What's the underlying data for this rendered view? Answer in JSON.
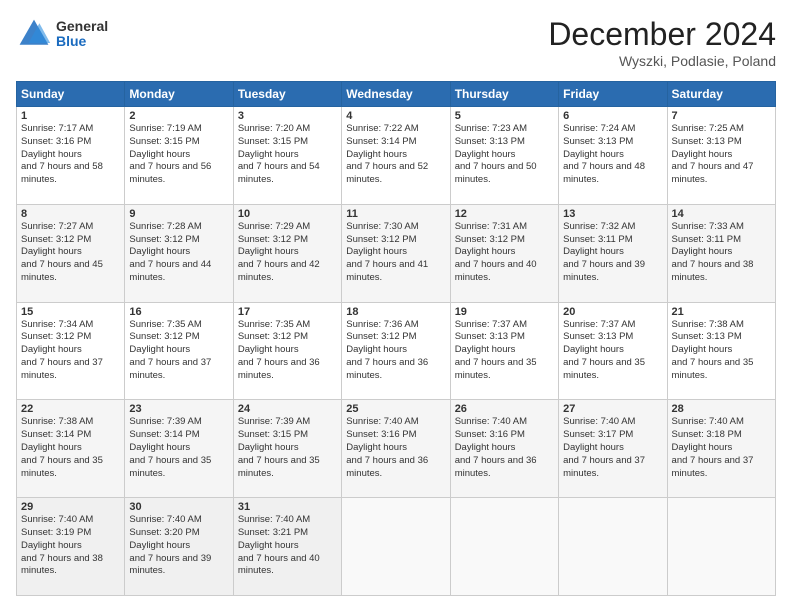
{
  "header": {
    "logo_general": "General",
    "logo_blue": "Blue",
    "title": "December 2024",
    "location": "Wyszki, Podlasie, Poland"
  },
  "days_of_week": [
    "Sunday",
    "Monday",
    "Tuesday",
    "Wednesday",
    "Thursday",
    "Friday",
    "Saturday"
  ],
  "weeks": [
    [
      {
        "day": "1",
        "sunrise": "7:17 AM",
        "sunset": "3:16 PM",
        "daylight": "7 hours and 58 minutes."
      },
      {
        "day": "2",
        "sunrise": "7:19 AM",
        "sunset": "3:15 PM",
        "daylight": "7 hours and 56 minutes."
      },
      {
        "day": "3",
        "sunrise": "7:20 AM",
        "sunset": "3:15 PM",
        "daylight": "7 hours and 54 minutes."
      },
      {
        "day": "4",
        "sunrise": "7:22 AM",
        "sunset": "3:14 PM",
        "daylight": "7 hours and 52 minutes."
      },
      {
        "day": "5",
        "sunrise": "7:23 AM",
        "sunset": "3:13 PM",
        "daylight": "7 hours and 50 minutes."
      },
      {
        "day": "6",
        "sunrise": "7:24 AM",
        "sunset": "3:13 PM",
        "daylight": "7 hours and 48 minutes."
      },
      {
        "day": "7",
        "sunrise": "7:25 AM",
        "sunset": "3:13 PM",
        "daylight": "7 hours and 47 minutes."
      }
    ],
    [
      {
        "day": "8",
        "sunrise": "7:27 AM",
        "sunset": "3:12 PM",
        "daylight": "7 hours and 45 minutes."
      },
      {
        "day": "9",
        "sunrise": "7:28 AM",
        "sunset": "3:12 PM",
        "daylight": "7 hours and 44 minutes."
      },
      {
        "day": "10",
        "sunrise": "7:29 AM",
        "sunset": "3:12 PM",
        "daylight": "7 hours and 42 minutes."
      },
      {
        "day": "11",
        "sunrise": "7:30 AM",
        "sunset": "3:12 PM",
        "daylight": "7 hours and 41 minutes."
      },
      {
        "day": "12",
        "sunrise": "7:31 AM",
        "sunset": "3:12 PM",
        "daylight": "7 hours and 40 minutes."
      },
      {
        "day": "13",
        "sunrise": "7:32 AM",
        "sunset": "3:11 PM",
        "daylight": "7 hours and 39 minutes."
      },
      {
        "day": "14",
        "sunrise": "7:33 AM",
        "sunset": "3:11 PM",
        "daylight": "7 hours and 38 minutes."
      }
    ],
    [
      {
        "day": "15",
        "sunrise": "7:34 AM",
        "sunset": "3:12 PM",
        "daylight": "7 hours and 37 minutes."
      },
      {
        "day": "16",
        "sunrise": "7:35 AM",
        "sunset": "3:12 PM",
        "daylight": "7 hours and 37 minutes."
      },
      {
        "day": "17",
        "sunrise": "7:35 AM",
        "sunset": "3:12 PM",
        "daylight": "7 hours and 36 minutes."
      },
      {
        "day": "18",
        "sunrise": "7:36 AM",
        "sunset": "3:12 PM",
        "daylight": "7 hours and 36 minutes."
      },
      {
        "day": "19",
        "sunrise": "7:37 AM",
        "sunset": "3:13 PM",
        "daylight": "7 hours and 35 minutes."
      },
      {
        "day": "20",
        "sunrise": "7:37 AM",
        "sunset": "3:13 PM",
        "daylight": "7 hours and 35 minutes."
      },
      {
        "day": "21",
        "sunrise": "7:38 AM",
        "sunset": "3:13 PM",
        "daylight": "7 hours and 35 minutes."
      }
    ],
    [
      {
        "day": "22",
        "sunrise": "7:38 AM",
        "sunset": "3:14 PM",
        "daylight": "7 hours and 35 minutes."
      },
      {
        "day": "23",
        "sunrise": "7:39 AM",
        "sunset": "3:14 PM",
        "daylight": "7 hours and 35 minutes."
      },
      {
        "day": "24",
        "sunrise": "7:39 AM",
        "sunset": "3:15 PM",
        "daylight": "7 hours and 35 minutes."
      },
      {
        "day": "25",
        "sunrise": "7:40 AM",
        "sunset": "3:16 PM",
        "daylight": "7 hours and 36 minutes."
      },
      {
        "day": "26",
        "sunrise": "7:40 AM",
        "sunset": "3:16 PM",
        "daylight": "7 hours and 36 minutes."
      },
      {
        "day": "27",
        "sunrise": "7:40 AM",
        "sunset": "3:17 PM",
        "daylight": "7 hours and 37 minutes."
      },
      {
        "day": "28",
        "sunrise": "7:40 AM",
        "sunset": "3:18 PM",
        "daylight": "7 hours and 37 minutes."
      }
    ],
    [
      {
        "day": "29",
        "sunrise": "7:40 AM",
        "sunset": "3:19 PM",
        "daylight": "7 hours and 38 minutes."
      },
      {
        "day": "30",
        "sunrise": "7:40 AM",
        "sunset": "3:20 PM",
        "daylight": "7 hours and 39 minutes."
      },
      {
        "day": "31",
        "sunrise": "7:40 AM",
        "sunset": "3:21 PM",
        "daylight": "7 hours and 40 minutes."
      },
      null,
      null,
      null,
      null
    ]
  ]
}
